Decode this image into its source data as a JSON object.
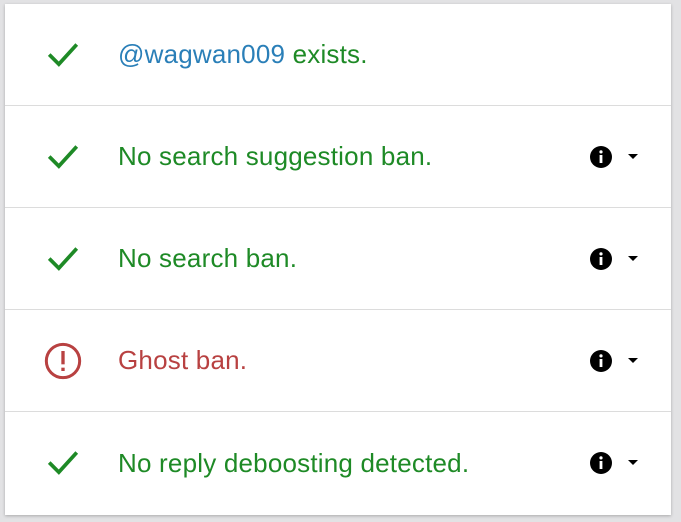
{
  "colors": {
    "ok": "#1e8a26",
    "bad": "#b84141",
    "link": "#2a7fb8"
  },
  "results": [
    {
      "status": "ok",
      "icon": "check-icon",
      "username": "@wagwan009",
      "text": " exists.",
      "has_controls": false
    },
    {
      "status": "ok",
      "icon": "check-icon",
      "text": "No search suggestion ban.",
      "has_controls": true
    },
    {
      "status": "ok",
      "icon": "check-icon",
      "text": "No search ban.",
      "has_controls": true
    },
    {
      "status": "bad",
      "icon": "alert-circle-icon",
      "text": "Ghost ban.",
      "has_controls": true
    },
    {
      "status": "ok",
      "icon": "check-icon",
      "text": "No reply deboosting detected.",
      "has_controls": true
    }
  ]
}
